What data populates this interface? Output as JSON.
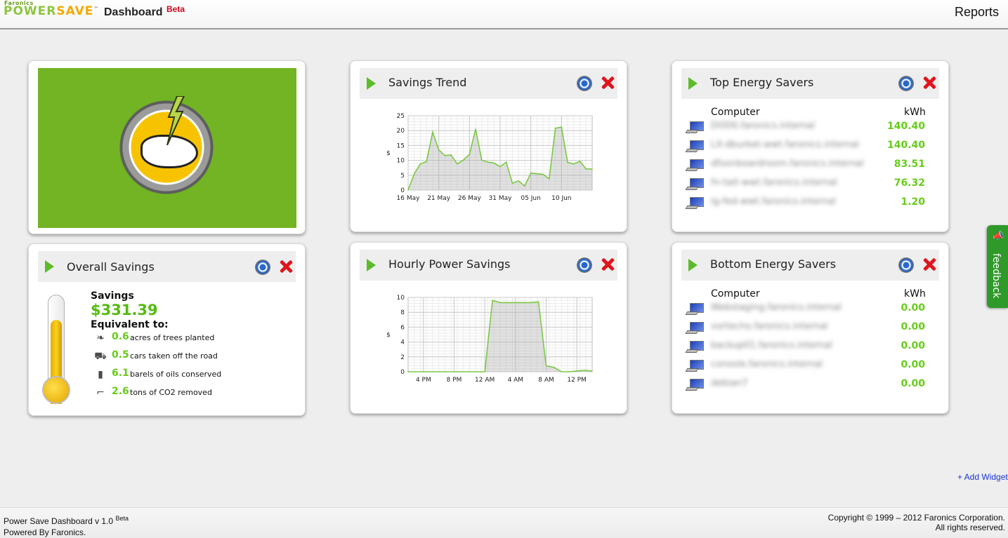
{
  "header": {
    "brand_small": "Faronics",
    "brand_a": "POWER",
    "brand_b": "SAVE",
    "brand_tm": "™",
    "title": "Dashboard",
    "beta": "Beta",
    "reports_label": "Reports"
  },
  "widgets": {
    "savings_trend": {
      "title": "Savings Trend"
    },
    "top_savers": {
      "title": "Top Energy Savers",
      "col_computer": "Computer",
      "col_kwh": "kWh",
      "rows": [
        {
          "name": "DOD0.faronics.internal",
          "kwh": "140.40"
        },
        {
          "name": "LX-dburket-wwt.faronics.internal",
          "kwh": "140.40"
        },
        {
          "name": "dfoonboardroom.faronics.internal",
          "kwh": "83.51"
        },
        {
          "name": "fn-tait-wwt.faronics.internal",
          "kwh": "76.32"
        },
        {
          "name": "lg-fed-wwt.faronics.internal",
          "kwh": "1.20"
        }
      ]
    },
    "overall_savings": {
      "title": "Overall Savings",
      "savings_label": "Savings",
      "amount": "$331.39",
      "equivalent_label": "Equivalent to:",
      "items": [
        {
          "icon": "leaf-icon",
          "glyph": "❧",
          "value": "0.6",
          "text": "acres of trees planted"
        },
        {
          "icon": "car-icon",
          "glyph": "⛟",
          "value": "0.5",
          "text": "cars taken off the road"
        },
        {
          "icon": "oil-barrel-icon",
          "glyph": "▮",
          "value": "6.1",
          "text": "barels of oils conserved"
        },
        {
          "icon": "co2-pipe-icon",
          "glyph": "⌐",
          "value": "2.6",
          "text": "tons of CO2 removed"
        }
      ]
    },
    "hourly_savings": {
      "title": "Hourly Power Savings"
    },
    "bottom_savers": {
      "title": "Bottom Energy Savers",
      "col_computer": "Computer",
      "col_kwh": "kWh",
      "rows": [
        {
          "name": "Webstaging.faronics.internal",
          "kwh": "0.00"
        },
        {
          "name": "vortecho.faronics.internal",
          "kwh": "0.00"
        },
        {
          "name": "backup01.faronics.internal",
          "kwh": "0.00"
        },
        {
          "name": "console.faronics.internal",
          "kwh": "0.00"
        },
        {
          "name": "debian7",
          "kwh": "0.00"
        }
      ]
    }
  },
  "feedback_label": "feedback",
  "add_widget_label": "+ Add Widget",
  "footer": {
    "left_line1": "Power Save Dashboard v 1.0",
    "left_beta": "Beta",
    "left_line2": "Powered By Faronics.",
    "right_line1": "Copyright © 1999 – 2012 Faronics Corporation.",
    "right_line2": "All rights reserved."
  },
  "colors": {
    "accent_green": "#66cc1a",
    "logo_green": "#72b423",
    "close_red": "#e0141c",
    "line_green": "#7ac943"
  },
  "chart_data": [
    {
      "type": "area",
      "ylabel": "$",
      "ylim": [
        0,
        25
      ],
      "yticks": [
        "0",
        "5",
        "10",
        "15",
        "20",
        "25"
      ],
      "x_ticks": [
        "16 May",
        "21 May",
        "26 May",
        "31 May",
        "05 Jun",
        "10 Jun"
      ],
      "x_tick_days": [
        0,
        5,
        10,
        15,
        20,
        25
      ],
      "x_days": [
        0,
        1,
        2,
        3,
        4,
        5,
        6,
        7,
        8,
        9,
        10,
        11,
        12,
        13,
        14,
        15,
        16,
        17,
        18,
        19,
        20,
        21,
        22,
        23,
        24,
        25,
        26,
        27,
        28,
        29,
        30
      ],
      "values": [
        0,
        5.5,
        8.8,
        9.6,
        19.5,
        13.5,
        11.6,
        11.8,
        8.8,
        10.1,
        12,
        20.5,
        10.1,
        9.4,
        9.1,
        7.9,
        9.4,
        2.3,
        3.1,
        1.4,
        5.7,
        5.5,
        5.3,
        3.8,
        20.8,
        21.2,
        9.3,
        8.8,
        9.7,
        7.1,
        7.1
      ]
    },
    {
      "type": "area",
      "ylabel": "$",
      "ylim": [
        0,
        10
      ],
      "yticks": [
        "0",
        "2",
        "4",
        "6",
        "8",
        "10"
      ],
      "x_ticks": [
        "4 PM",
        "8 PM",
        "12 AM",
        "4 AM",
        "8 AM",
        "12 PM"
      ],
      "x_tick_hours": [
        2,
        6,
        10,
        14,
        18,
        22
      ],
      "x_hours": [
        0,
        1,
        2,
        3,
        4,
        5,
        6,
        7,
        8,
        9,
        10,
        11,
        12,
        13,
        14,
        15,
        16,
        17,
        18,
        19,
        20,
        21,
        22,
        23,
        24
      ],
      "values": [
        0,
        0,
        0,
        0,
        0,
        0,
        0,
        0,
        0,
        0,
        0,
        9.6,
        9.3,
        9.3,
        9.3,
        9.3,
        9.3,
        9.4,
        0.8,
        0.6,
        0,
        0,
        0.1,
        0.2,
        0.1
      ]
    }
  ]
}
